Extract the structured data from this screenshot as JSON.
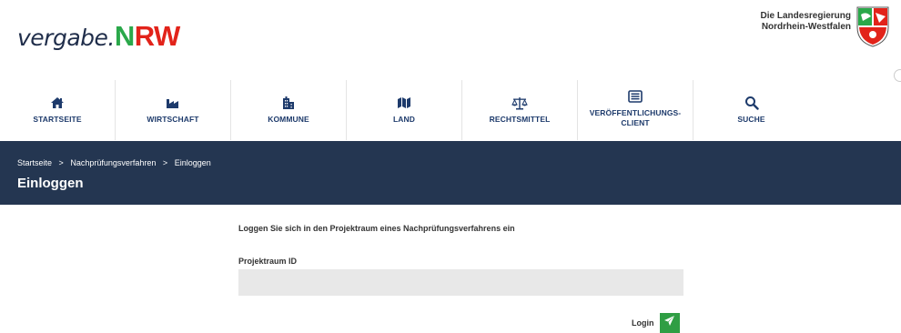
{
  "header": {
    "logo_part1": "vergabe.",
    "logo_part2": "N",
    "logo_part3": "RW",
    "gov_line1": "Die Landesregierung",
    "gov_line2": "Nordrhein-Westfalen"
  },
  "nav": {
    "items": [
      {
        "label": "STARTSEITE",
        "icon": "home-icon"
      },
      {
        "label": "WIRTSCHAFT",
        "icon": "factory-icon"
      },
      {
        "label": "KOMMUNE",
        "icon": "building-icon"
      },
      {
        "label": "LAND",
        "icon": "map-icon"
      },
      {
        "label": "RECHTSMITTEL",
        "icon": "scale-icon"
      },
      {
        "label": "VERÖFFENTLICHUNGS-",
        "label2": "CLIENT",
        "icon": "newspaper-icon"
      },
      {
        "label": "SUCHE",
        "icon": "search-icon"
      }
    ]
  },
  "breadcrumb": {
    "items": [
      "Startseite",
      "Nachprüfungsverfahren",
      "Einloggen"
    ],
    "separator": ">"
  },
  "page": {
    "title": "Einloggen"
  },
  "form": {
    "intro": "Loggen Sie sich in den Projektraum eines Nachprüfungsverfahrens ein",
    "field_label": "Projektraum ID",
    "field_value": "",
    "field_placeholder": "",
    "login_label": "Login"
  },
  "colors": {
    "nav_text": "#1d3a6b",
    "banner_bg": "#243651",
    "login_green": "#2f9e44",
    "logo_green": "#2aa84a",
    "logo_red": "#e2231a"
  }
}
